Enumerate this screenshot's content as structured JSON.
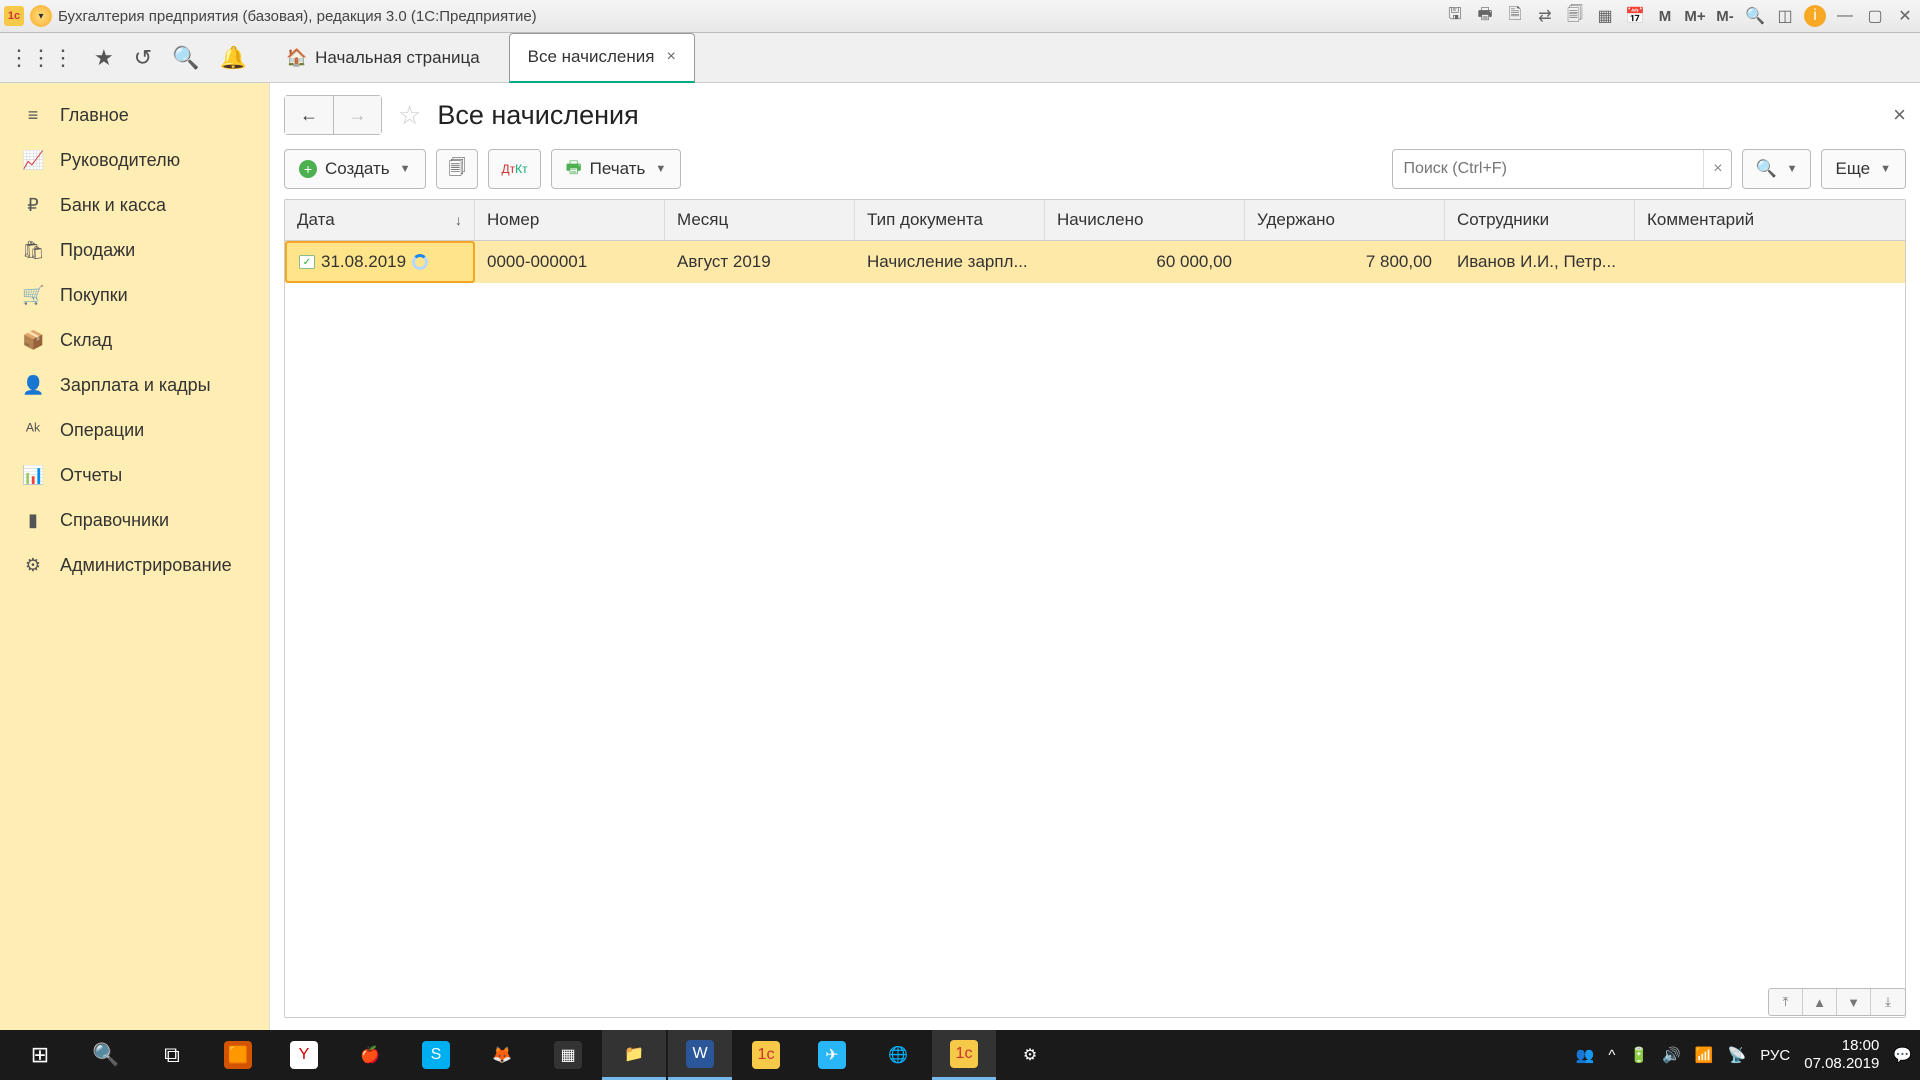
{
  "titlebar": {
    "title": "Бухгалтерия предприятия (базовая), редакция 3.0  (1С:Предприятие)"
  },
  "tabs": {
    "home_label": "Начальная страница",
    "active_label": "Все начисления"
  },
  "sidebar": {
    "items": [
      {
        "icon": "≡",
        "label": "Главное"
      },
      {
        "icon": "📈",
        "label": "Руководителю"
      },
      {
        "icon": "₽",
        "label": "Банк и касса"
      },
      {
        "icon": "🛍",
        "label": "Продажи"
      },
      {
        "icon": "🛒",
        "label": "Покупки"
      },
      {
        "icon": "📦",
        "label": "Склад"
      },
      {
        "icon": "👤",
        "label": "Зарплата и кадры"
      },
      {
        "icon": "ᴬᵏ",
        "label": "Операции"
      },
      {
        "icon": "📊",
        "label": "Отчеты"
      },
      {
        "icon": "▮",
        "label": "Справочники"
      },
      {
        "icon": "⚙",
        "label": "Администрирование"
      }
    ]
  },
  "page": {
    "title": "Все начисления"
  },
  "toolbar": {
    "create_label": "Создать",
    "print_label": "Печать",
    "more_label": "Еще",
    "search_placeholder": "Поиск (Ctrl+F)"
  },
  "grid": {
    "columns": [
      "Дата",
      "Номер",
      "Месяц",
      "Тип документа",
      "Начислено",
      "Удержано",
      "Сотрудники",
      "Комментарий"
    ],
    "rows": [
      {
        "date": "31.08.2019",
        "number": "0000-000001",
        "month": "Август 2019",
        "doc_type": "Начисление зарпл...",
        "accrued": "60 000,00",
        "withheld": "7 800,00",
        "employees": "Иванов И.И., Петр...",
        "comment": ""
      }
    ]
  },
  "taskbar": {
    "lang": "РУС",
    "time": "18:00",
    "date": "07.08.2019"
  }
}
